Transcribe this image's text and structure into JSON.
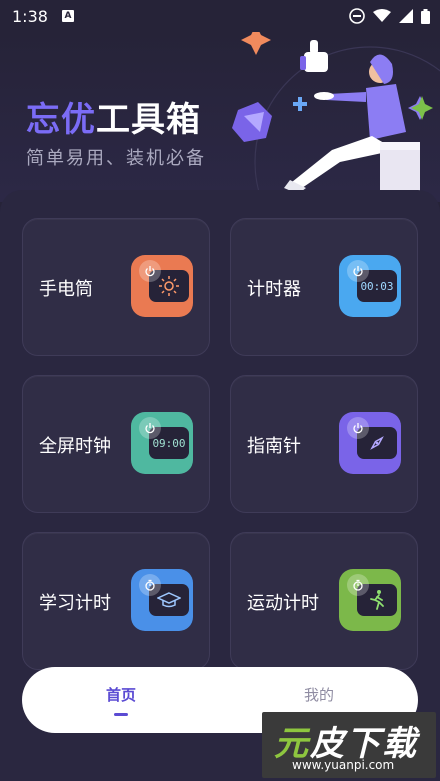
{
  "status_bar": {
    "time": "1:38",
    "app_badge": "A"
  },
  "hero": {
    "title_part1": "忘优",
    "title_part2": "工具箱",
    "subtitle": "简单易用、装机必备"
  },
  "tools": [
    {
      "label": "手电筒",
      "icon": "flashlight-icon",
      "color": "#ea7a52",
      "screen_text": ""
    },
    {
      "label": "计时器",
      "icon": "timer-icon",
      "color": "#4aa8f0",
      "screen_text": "00:03"
    },
    {
      "label": "全屏时钟",
      "icon": "clock-icon",
      "color": "#4fb8a0",
      "screen_text": "09:00"
    },
    {
      "label": "指南针",
      "icon": "compass-icon",
      "color": "#7a64e8",
      "screen_text": ""
    },
    {
      "label": "学习计时",
      "icon": "graduation-cap-icon",
      "color": "#4a90e8",
      "screen_text": ""
    },
    {
      "label": "运动计时",
      "icon": "runner-icon",
      "color": "#7cb84a",
      "screen_text": ""
    }
  ],
  "bottom_nav": {
    "home": "首页",
    "mine": "我的"
  },
  "watermark": {
    "brand_part1": "元",
    "brand_part2": "皮下载",
    "url": "www.yuanpi.com"
  }
}
